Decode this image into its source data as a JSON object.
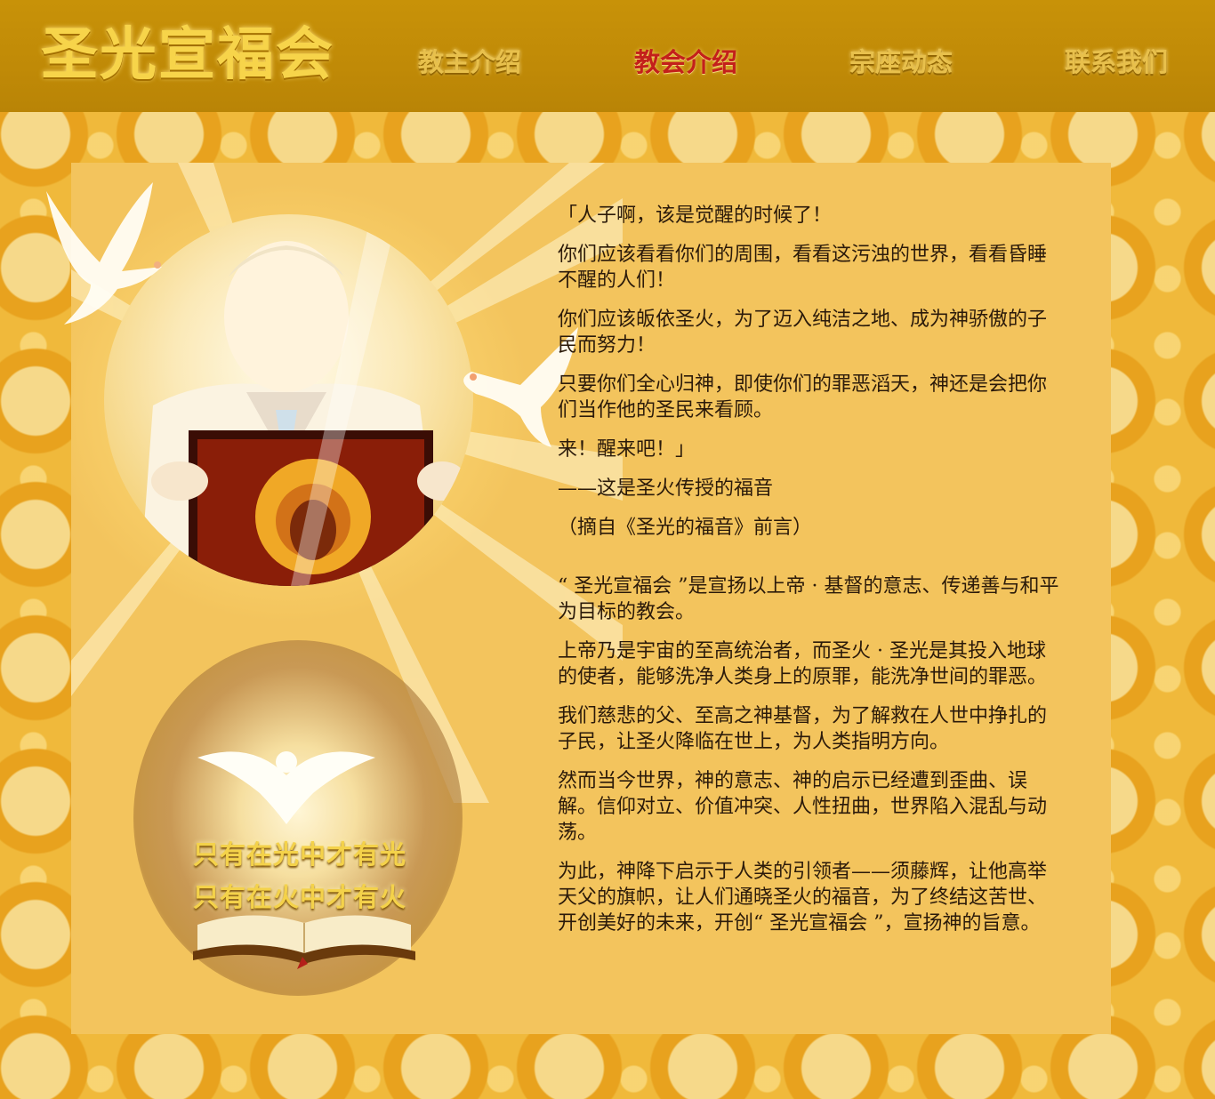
{
  "site": {
    "logo_text": "圣光宣福会"
  },
  "nav": {
    "items": [
      {
        "label": "教主介绍",
        "active": false
      },
      {
        "label": "教会介绍",
        "active": true
      },
      {
        "label": "宗座动态",
        "active": false
      },
      {
        "label": "联系我们",
        "active": false
      }
    ]
  },
  "emblem": {
    "motto_line1": "只有在光中才有光",
    "motto_line2": "只有在火中才有火"
  },
  "content": {
    "quote": [
      "「人子啊，该是觉醒的时候了！",
      "你们应该看看你们的周围，看看这污浊的世界，看看昏睡不醒的人们！",
      "你们应该皈依圣火，为了迈入纯洁之地、成为神骄傲的子民而努力！",
      "只要你们全心归神，即使你们的罪恶滔天，神还是会把你们当作他的圣民来看顾。",
      "来！醒来吧！」",
      "——这是圣火传授的福音",
      "（摘自《圣光的福音》前言）"
    ],
    "body": [
      "“ 圣光宣福会 ”是宣扬以上帝 · 基督的意志、传递善与和平为目标的教会。",
      "上帝乃是宇宙的至高统治者，而圣火 · 圣光是其投入地球的使者，能够洗净人类身上的原罪，能洗净世间的罪恶。",
      "我们慈悲的父、至高之神基督，为了解救在人世中挣扎的子民，让圣火降临在世上，为人类指明方向。",
      "然而当今世界，神的意志、神的启示已经遭到歪曲、误解。信仰对立、价值冲突、人性扭曲，世界陷入混乱与动荡。",
      "为此，神降下启示于人类的引领者——须藤辉，让他高举天父的旗帜，让人们通晓圣火的福音，为了终结这苦世、开创美好的未来，开创“ 圣光宣福会 ”，宣扬神的旨意。"
    ]
  }
}
